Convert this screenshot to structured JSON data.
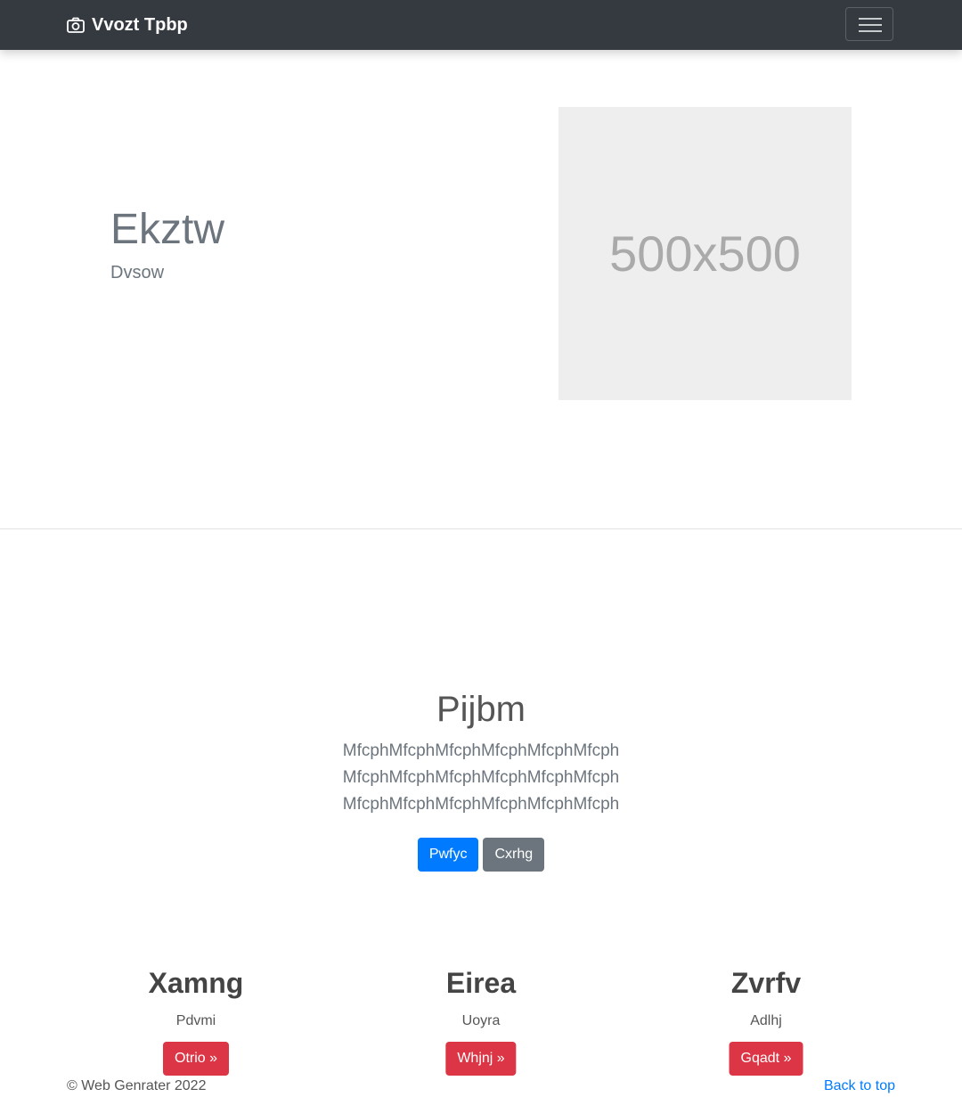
{
  "navbar": {
    "brand": "Vvozt Tpbp",
    "brand_icon": "camera-icon",
    "toggle_icon": "hamburger-icon"
  },
  "hero": {
    "title": "Ekztw",
    "subtitle": "Dvsow",
    "image_label": "500x500"
  },
  "section": {
    "title": "Pijbm",
    "lines": [
      "MfcphMfcphMfcphMfcphMfcphMfcph",
      "MfcphMfcphMfcphMfcphMfcphMfcph",
      "MfcphMfcphMfcphMfcphMfcphMfcph"
    ],
    "primary_button": "Pwfyc",
    "secondary_button": "Cxrhg"
  },
  "features": [
    {
      "title": "Xamng",
      "text": "Pdvmi",
      "button": "Otrio »"
    },
    {
      "title": "Eirea",
      "text": "Uoyra",
      "button": "Whjnj »"
    },
    {
      "title": "Zvrfv",
      "text": "Adlhj",
      "button": "Gqadt »"
    }
  ],
  "footer": {
    "copyright": "© Web Genrater 2022",
    "back_to_top": "Back to top"
  },
  "colors": {
    "navbar": "#343a40",
    "primary": "#007bff",
    "secondary": "#6c757d",
    "danger": "#dc3545",
    "placeholder": "#eeeeee"
  }
}
